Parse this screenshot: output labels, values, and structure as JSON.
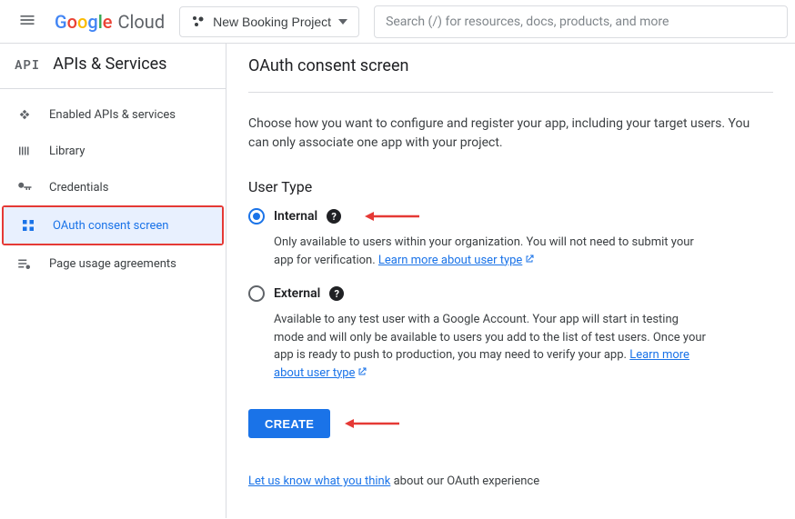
{
  "topbar": {
    "logo_cloud": "Cloud",
    "project_name": "New Booking Project",
    "search_placeholder": "Search (/) for resources, docs, products, and more"
  },
  "sidebar": {
    "api_label": "API",
    "title": "APIs & Services",
    "items": [
      {
        "label": "Enabled APIs & services"
      },
      {
        "label": "Library"
      },
      {
        "label": "Credentials"
      },
      {
        "label": "OAuth consent screen"
      },
      {
        "label": "Page usage agreements"
      }
    ]
  },
  "main": {
    "page_title": "OAuth consent screen",
    "intro": "Choose how you want to configure and register your app, including your target users. You can only associate one app with your project.",
    "section_title": "User Type",
    "internal": {
      "label": "Internal",
      "desc_before": "Only available to users within your organization. You will not need to submit your app for verification. ",
      "link": "Learn more about user type"
    },
    "external": {
      "label": "External",
      "desc_before": "Available to any test user with a Google Account. Your app will start in testing mode and will only be available to users you add to the list of test users. Once your app is ready to push to production, you may need to verify your app. ",
      "link": "Learn more about user type"
    },
    "create_label": "CREATE",
    "feedback_link": "Let us know what you think",
    "feedback_rest": " about our OAuth experience"
  }
}
